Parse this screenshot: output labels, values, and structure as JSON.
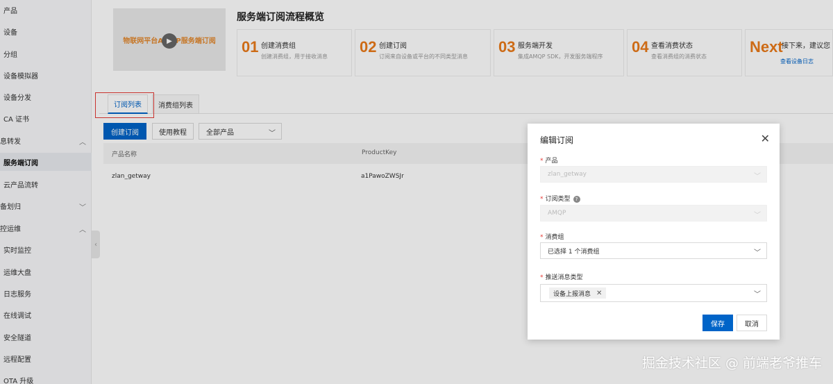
{
  "sidebar": {
    "items": [
      {
        "label": "产品",
        "active": false
      },
      {
        "label": "设备",
        "active": false
      },
      {
        "label": "分组",
        "active": false
      },
      {
        "label": "设备模拟器",
        "active": false
      },
      {
        "label": "设备分发",
        "active": false
      },
      {
        "label": "CA 证书",
        "active": false
      },
      {
        "label": "息转发",
        "group": true,
        "chevron": "︿"
      },
      {
        "label": "服务端订阅",
        "active": true
      },
      {
        "label": "云产品流转",
        "active": false
      },
      {
        "label": "备划归",
        "group": true,
        "chevron": "﹀"
      },
      {
        "label": "控运维",
        "group": true,
        "chevron": "︿"
      },
      {
        "label": "实时监控",
        "active": false
      },
      {
        "label": "运维大盘",
        "active": false
      },
      {
        "label": "日志服务",
        "active": false
      },
      {
        "label": "在线调试",
        "active": false
      },
      {
        "label": "安全隧道",
        "active": false
      },
      {
        "label": "远程配置",
        "active": false
      },
      {
        "label": "OTA 升级",
        "active": false
      }
    ]
  },
  "video": {
    "title": "物联网平台AMQP服务端订阅"
  },
  "flow": {
    "title": "服务端订阅流程概览",
    "steps": [
      {
        "num": "01",
        "title": "创建消费组",
        "desc": "创建消费组，用于接收消息"
      },
      {
        "num": "02",
        "title": "创建订阅",
        "desc": "订阅来自设备或平台的不同类型消息"
      },
      {
        "num": "03",
        "title": "服务端开发",
        "desc": "集成AMQP SDK，开发服务端程序"
      },
      {
        "num": "04",
        "title": "查看消费状态",
        "desc": "查看消费组的消费状态"
      },
      {
        "num": "Next",
        "title": "接下来，建议您",
        "link": "查看设备日志"
      }
    ]
  },
  "tabs": [
    {
      "label": "订阅列表",
      "active": true
    },
    {
      "label": "消费组列表",
      "active": false
    }
  ],
  "toolbar": {
    "create_label": "创建订阅",
    "tutorial_label": "使用教程",
    "product_filter": "全部产品"
  },
  "table": {
    "columns": [
      "产品名称",
      "ProductKey"
    ],
    "rows": [
      [
        "zlan_getway",
        "a1PawoZWSJr"
      ]
    ]
  },
  "dialog": {
    "title": "编辑订阅",
    "product_label": "产品",
    "product_value": "zlan_getway",
    "type_label": "订阅类型",
    "type_value": "AMQP",
    "group_label": "消费组",
    "group_value": "已选择 1 个消费组",
    "push_label": "推送消息类型",
    "push_tag": "设备上报消息",
    "save_label": "保存",
    "cancel_label": "取消"
  },
  "watermark": "掘金技术社区 @ 前端老爷推车"
}
